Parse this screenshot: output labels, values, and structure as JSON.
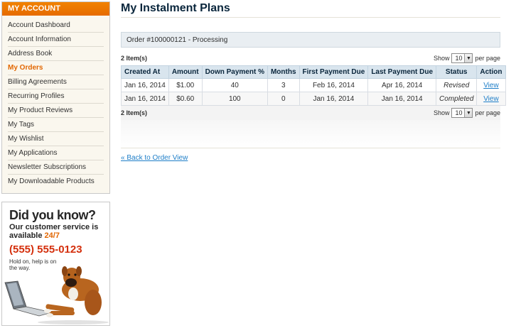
{
  "sidebar": {
    "title": "My Account",
    "items": [
      {
        "label": "Account Dashboard"
      },
      {
        "label": "Account Information"
      },
      {
        "label": "Address Book"
      },
      {
        "label": "My Orders",
        "active": true
      },
      {
        "label": "Billing Agreements"
      },
      {
        "label": "Recurring Profiles"
      },
      {
        "label": "My Product Reviews"
      },
      {
        "label": "My Tags"
      },
      {
        "label": "My Wishlist"
      },
      {
        "label": "My Applications"
      },
      {
        "label": "Newsletter Subscriptions"
      },
      {
        "label": "My Downloadable Products"
      }
    ]
  },
  "promo": {
    "title": "Did you know?",
    "line1": "Our customer service is",
    "line2_prefix": "available ",
    "line2_highlight": "24/7",
    "phone": "(555) 555-0123",
    "hold": "Hold on, help is on the way."
  },
  "main": {
    "title": "My Instalment Plans",
    "order_label": "Order #100000121 - Processing",
    "pager": {
      "count": "2 Item(s)",
      "show": "Show",
      "limit": "10",
      "per_page": "per page"
    },
    "columns": [
      "Created At",
      "Amount",
      "Down Payment %",
      "Months",
      "First Payment Due",
      "Last Payment Due",
      "Status",
      "Action"
    ],
    "rows": [
      {
        "created": "Jan 16, 2014",
        "amount": "$1.00",
        "down": "40",
        "months": "3",
        "first": "Feb 16, 2014",
        "last": "Apr 16, 2014",
        "status": "Revised",
        "action": "View"
      },
      {
        "created": "Jan 16, 2014",
        "amount": "$0.60",
        "down": "100",
        "months": "0",
        "first": "Jan 16, 2014",
        "last": "Jan 16, 2014",
        "status": "Completed",
        "action": "View"
      }
    ],
    "back_link": "« Back to Order View"
  },
  "colors": {
    "accent": "#e26703",
    "header_blue": "#d9e5ee",
    "link": "#1e7ec8"
  }
}
